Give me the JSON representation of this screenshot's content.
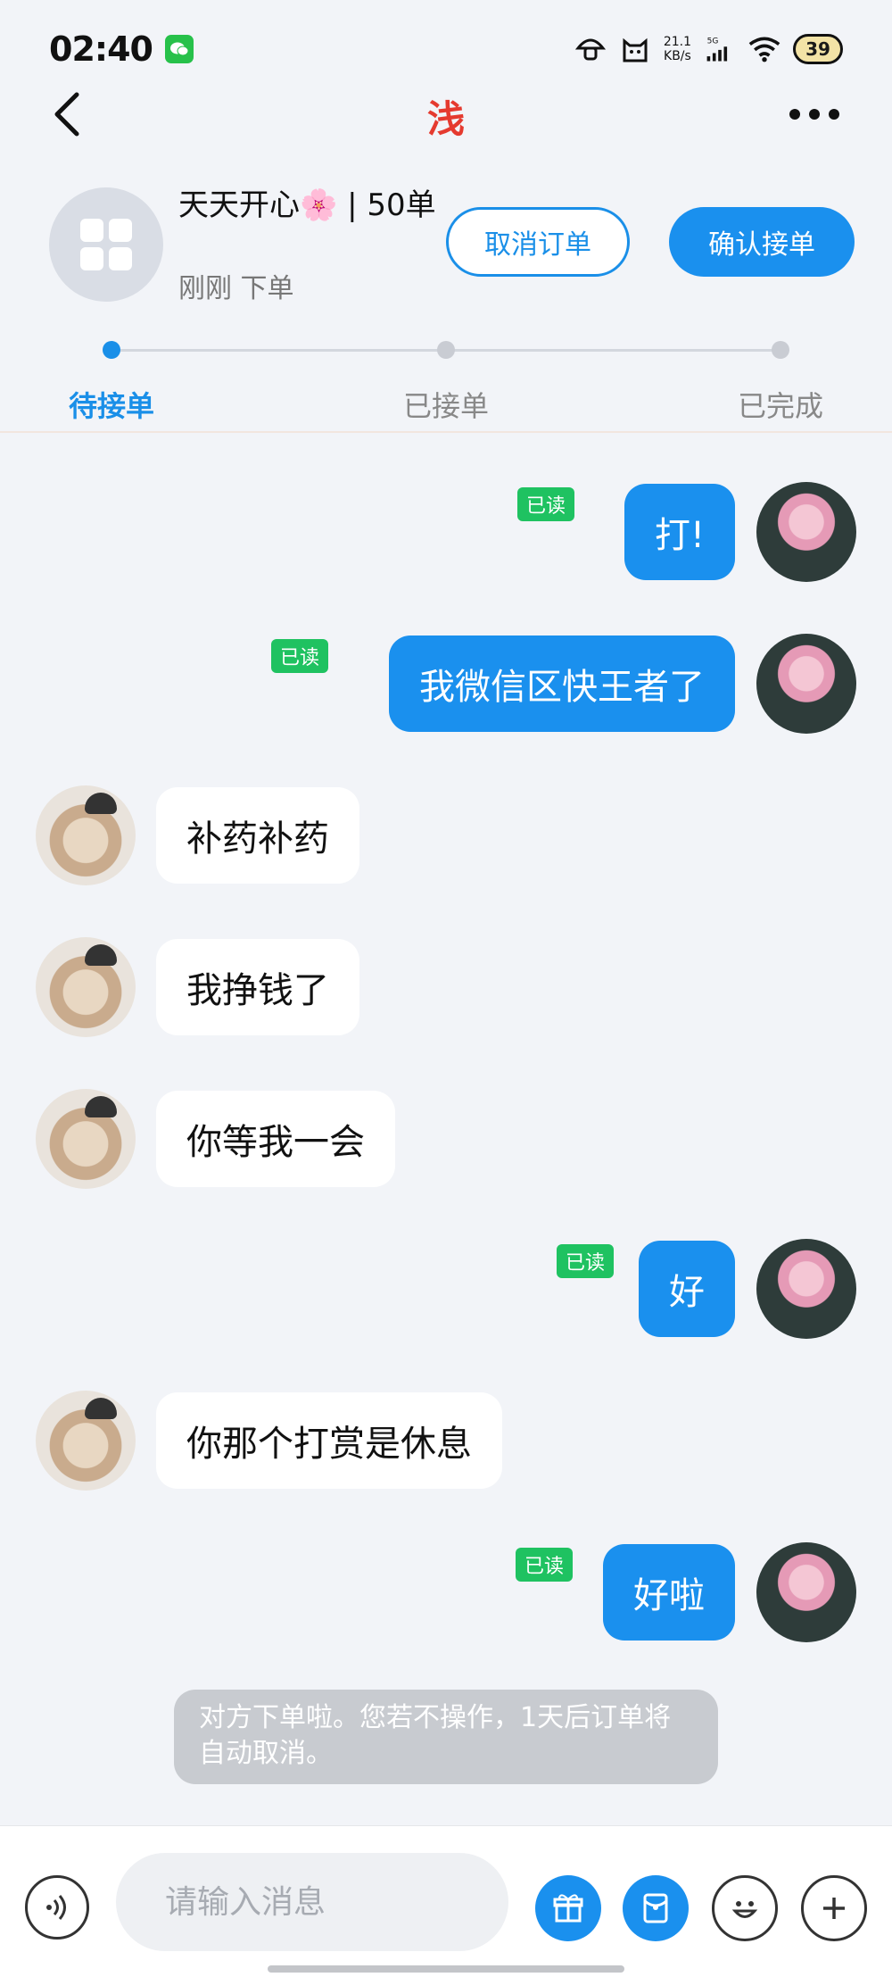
{
  "status_bar": {
    "time": "02:40",
    "net_speed_value": "21.1",
    "net_speed_unit": "KB/s",
    "signal_label": "5G",
    "battery": "39"
  },
  "nav": {
    "title": "浅"
  },
  "order": {
    "title": "天天开心🌸 | 50单",
    "subtitle": "刚刚 下单",
    "cancel_label": "取消订单",
    "confirm_label": "确认接单"
  },
  "progress": {
    "steps": [
      {
        "label": "待接单",
        "active": true
      },
      {
        "label": "已接单",
        "active": false
      },
      {
        "label": "已完成",
        "active": false
      }
    ]
  },
  "messages": [
    {
      "side": "out",
      "text": "打!",
      "read": "已读"
    },
    {
      "side": "out",
      "text": "我微信区快王者了",
      "read": "已读"
    },
    {
      "side": "in",
      "text": "补药补药"
    },
    {
      "side": "in",
      "text": "我挣钱了"
    },
    {
      "side": "in",
      "text": "你等我一会"
    },
    {
      "side": "out",
      "text": "好",
      "read": "已读"
    },
    {
      "side": "in",
      "text": "你那个打赏是休息"
    },
    {
      "side": "out",
      "text": "好啦",
      "read": "已读"
    }
  ],
  "notice": "对方下单啦。您若不操作，1天后订单将自动取消。",
  "input": {
    "placeholder": "请输入消息"
  },
  "colors": {
    "accent": "#1a90ee",
    "read_badge": "#1fc261",
    "title": "#e53a2f"
  }
}
